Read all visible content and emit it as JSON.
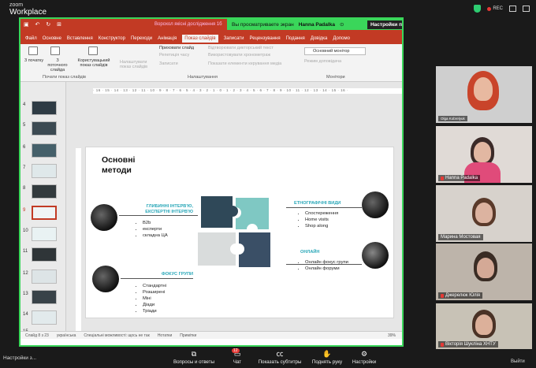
{
  "app": {
    "logo_line1": "zoom",
    "logo_line2": "Workplace",
    "rec_label": "REC"
  },
  "share": {
    "banner_text": "Вы просматриваете экран",
    "presenter": "Hanna Padalka",
    "settings": "Настройки п",
    "document_title": "Ворохол якісні дослідження 1б"
  },
  "ppt": {
    "menu": [
      "Файл",
      "Основне",
      "Вставлення",
      "Конструктор",
      "Переходи",
      "Анімація",
      "Показ слайдів",
      "Записати",
      "Рецензування",
      "Подання",
      "Довідка",
      "Допомо"
    ],
    "active_menu": "Показ слайдів",
    "ribbon": {
      "from_start": "З початку",
      "from_current": "З поточного слайда",
      "custom_show": "Користувацький показ слайдів",
      "group1": "Почати показ слайдів",
      "hide_slide": "Приховати слайд",
      "rehearse": "Репетиція часу",
      "record": "Записати",
      "setup": "Налаштувати показ слайдів",
      "cb1": "Відтворювати дикторський текст",
      "cb2": "Використовувати хронометраж",
      "cb3": "Показати елементи керування медіа",
      "group2": "Налаштування",
      "monitor": "Основний монітор",
      "presenter_view": "Режим доповідача",
      "group3": "Монітори"
    },
    "ruler": "· 16 · 15 · 14 · 13 · 12 · 11 · 10 · 9 · 8 · 7 · 6 · 5 · 4 · 3 · 2 · 1 · 0 · 1 · 2 · 3 · 4 · 5 · 6 · 7 · 8 · 9 · 10 · 11 · 12 · 13 · 14 · 15 · 16 ·",
    "thumb_numbers": [
      "4",
      "5",
      "6",
      "7",
      "8",
      "9",
      "10",
      "11",
      "12",
      "13",
      "14",
      "15"
    ],
    "status": {
      "slide": "Слайд 8 з 23",
      "lang": "українська",
      "accessibility": "Спеціальні можливості: щось не так",
      "notes": "Нотатки",
      "comments": "Примітки",
      "zoom": "39%"
    }
  },
  "slide": {
    "title": "Основні методи",
    "sections": [
      {
        "label": "ГЛИБИННІ ІНТЕРВ'Ю, ЕКСПЕРТНІ ІНТЕРВ'Ю",
        "items": [
          "B2b",
          "експерти",
          "складна ЦА"
        ]
      },
      {
        "label": "ФОКУС ГРУПИ",
        "items": [
          "Стандартні",
          "Розширені",
          "Міні",
          "Діади",
          "Тріади"
        ]
      },
      {
        "label": "ЕТНОГРАФІЧНІ ВИДИ",
        "items": [
          "Спостереження",
          "Home visits",
          "Shop along"
        ]
      },
      {
        "label": "ОНЛАЙН",
        "items": [
          "Онлайн фокус групи",
          "Онлайн форуми"
        ]
      }
    ]
  },
  "participants": [
    {
      "name": "Olga Kobrelyuk",
      "muted": false
    },
    {
      "name": "Hanna Padalka",
      "muted": true
    },
    {
      "name": "Марина Мостовая",
      "muted": false
    },
    {
      "name": "Джерелюк Юлія",
      "muted": true
    },
    {
      "name": "Вікторія Шукліна ХНТУ",
      "muted": true
    }
  ],
  "toolbar": {
    "left": "Настройки з...",
    "qa": "Вопросы и ответы",
    "chat": "Чат",
    "chat_badge": "12",
    "captions": "Показать субтитры",
    "raise": "Поднять руку",
    "settings": "Настройки",
    "exit": "Выйти"
  },
  "colors": {
    "ppt_red": "#c23a24",
    "share_green": "#3ad65a",
    "teal": "#29a7b8"
  }
}
